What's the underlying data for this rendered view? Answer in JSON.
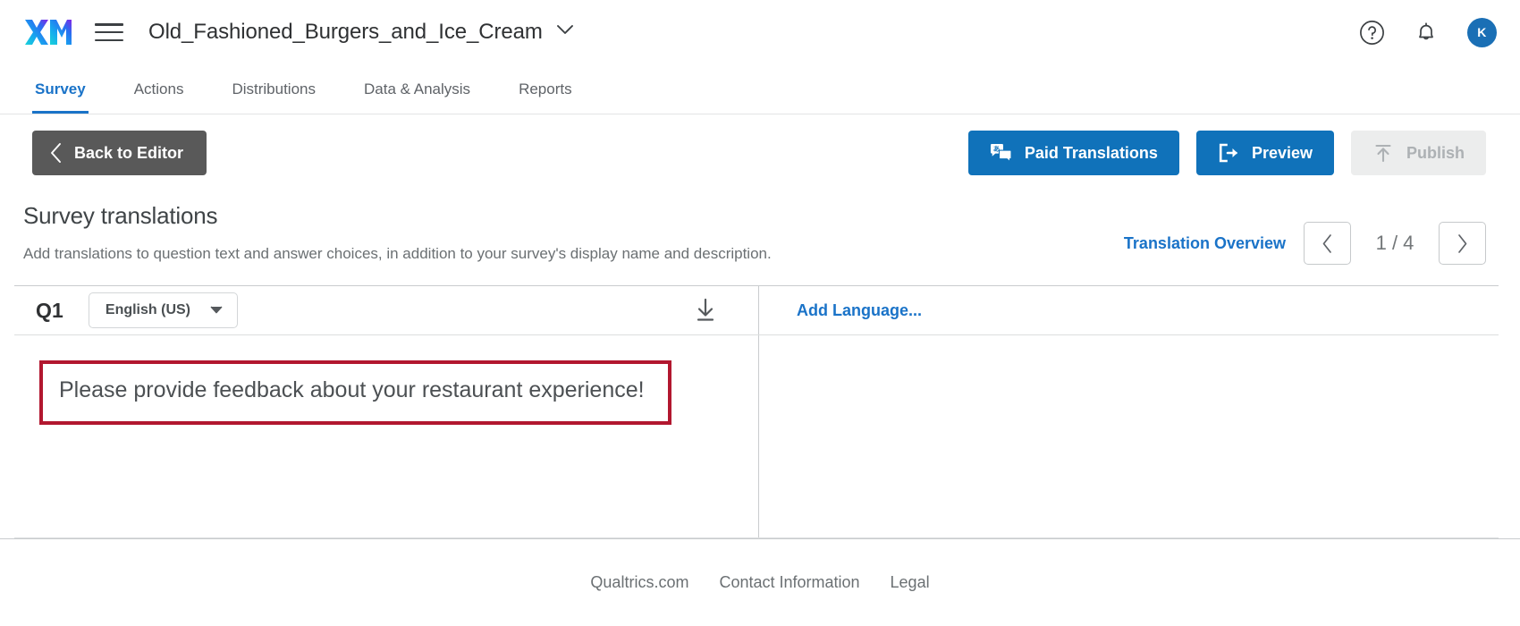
{
  "topbar": {
    "logo_alt": "XM",
    "menu_label": "Menu",
    "project_title": "Old_Fashioned_Burgers_and_Ice_Cream",
    "help_icon": "help-circle-icon",
    "notifications_icon": "bell-icon",
    "avatar_initial": "K"
  },
  "nav": {
    "tabs": [
      {
        "label": "Survey",
        "active": true
      },
      {
        "label": "Actions",
        "active": false
      },
      {
        "label": "Distributions",
        "active": false
      },
      {
        "label": "Data & Analysis",
        "active": false
      },
      {
        "label": "Reports",
        "active": false
      }
    ]
  },
  "actionbar": {
    "back_label": "Back to Editor",
    "paid_translations_label": "Paid Translations",
    "preview_label": "Preview",
    "publish_label": "Publish"
  },
  "section": {
    "title": "Survey translations",
    "description": "Add translations to question text and answer choices, in addition to your survey's display name and description.",
    "overview_link": "Translation Overview",
    "page_indicator": "1 / 4",
    "prev_label": "Previous",
    "next_label": "Next"
  },
  "table": {
    "question_id": "Q1",
    "language": "English (US)",
    "download_label": "Download",
    "add_language_label": "Add Language...",
    "question_text": "Please provide feedback about your restaurant experience!",
    "highlight_color": "#b2172f"
  },
  "footer": {
    "links": [
      "Qualtrics.com",
      "Contact Information",
      "Legal"
    ]
  },
  "colors": {
    "primary_blue": "#1072ba",
    "link_blue": "#1a73c8",
    "dark_button": "#595959",
    "disabled_button": "#eceded",
    "highlight_red": "#b2172f"
  }
}
